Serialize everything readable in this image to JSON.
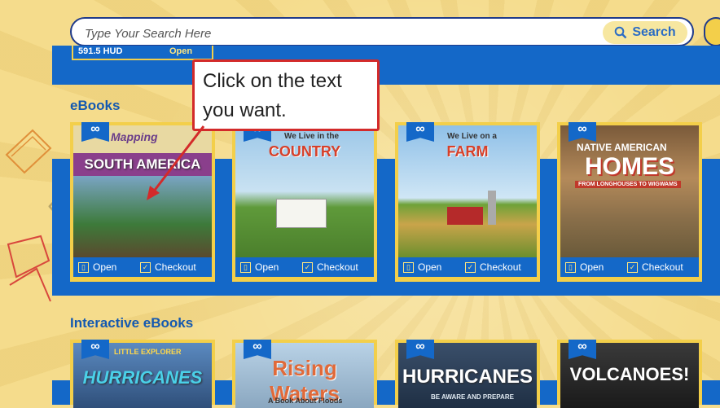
{
  "search": {
    "placeholder": "Type Your Search Here",
    "button_label": "Search"
  },
  "previous_row": {
    "card_label": "591.5 HUD",
    "open_label": "Open"
  },
  "callout": {
    "text": "Click on the text you want."
  },
  "sections": {
    "ebooks": {
      "title": "eBooks",
      "cards": [
        {
          "cover_title": "SOUTH AMERICA",
          "cover_sub": "Mapping",
          "open": "Open",
          "checkout": "Checkout"
        },
        {
          "cover_title": "COUNTRY",
          "cover_sub": "We Live in the",
          "open": "Open",
          "checkout": "Checkout"
        },
        {
          "cover_title": "FARM",
          "cover_sub": "We Live on a",
          "open": "Open",
          "checkout": "Checkout"
        },
        {
          "cover_title": "HOMES",
          "cover_sub": "NATIVE AMERICAN",
          "cover_sub2": "FROM LONGHOUSES TO WIGWAMS",
          "open": "Open",
          "checkout": "Checkout"
        }
      ]
    },
    "interactive": {
      "title": "Interactive eBooks",
      "cards": [
        {
          "cover_title": "HURRICANES",
          "cover_sub": "LITTLE EXPLORER"
        },
        {
          "cover_title": "Rising Waters",
          "cover_sub": "A Book About Floods"
        },
        {
          "cover_title": "HURRICANES",
          "cover_sub": "BE AWARE AND PREPARE"
        },
        {
          "cover_title": "VOLCANOES!",
          "cover_sub": ""
        }
      ]
    }
  },
  "icons": {
    "infinity": "∞",
    "search": "search-icon",
    "open": "open-book-icon",
    "checkout": "checkbox-icon"
  },
  "colors": {
    "band_blue": "#1468c8",
    "card_yellow": "#f3cf4a",
    "title_blue": "#1459b0",
    "callout_red": "#d32a2a"
  }
}
